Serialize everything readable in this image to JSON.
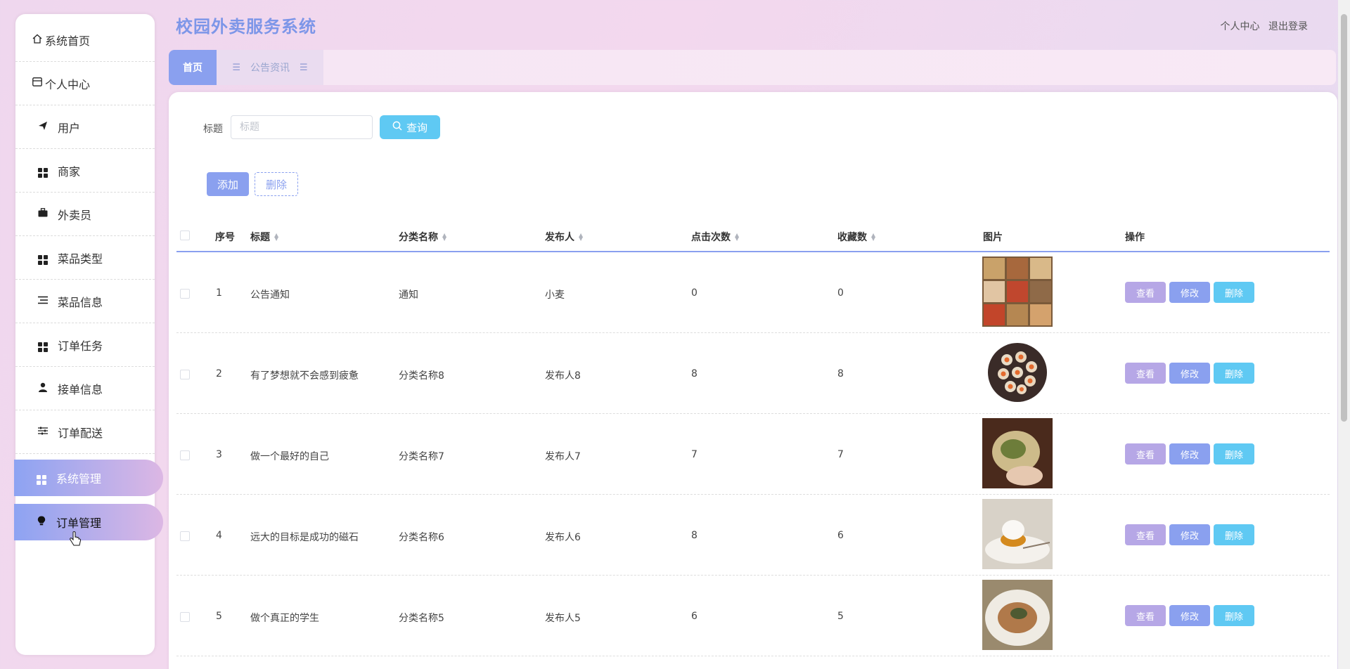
{
  "app": {
    "title": "校园外卖服务系统"
  },
  "header": {
    "profile": "个人中心",
    "logout": "退出登录"
  },
  "sidebar": {
    "items": [
      {
        "label": "系统首页",
        "icon": "home-icon"
      },
      {
        "label": "个人中心",
        "icon": "card-icon"
      },
      {
        "label": "用户",
        "icon": "send-icon"
      },
      {
        "label": "商家",
        "icon": "grid-icon"
      },
      {
        "label": "外卖员",
        "icon": "briefcase-icon"
      },
      {
        "label": "菜品类型",
        "icon": "grid-icon"
      },
      {
        "label": "菜品信息",
        "icon": "list-icon"
      },
      {
        "label": "订单任务",
        "icon": "grid-icon"
      },
      {
        "label": "接单信息",
        "icon": "user-icon"
      },
      {
        "label": "订单配送",
        "icon": "sliders-icon"
      },
      {
        "label": "系统管理",
        "icon": "grid-icon"
      },
      {
        "label": "订单管理",
        "icon": "bulb-icon"
      }
    ]
  },
  "tabs": [
    {
      "label": "首页"
    },
    {
      "label": "公告资讯"
    }
  ],
  "search": {
    "label": "标题",
    "placeholder": "标题",
    "button": "查询"
  },
  "actions": {
    "add": "添加",
    "delete": "删除"
  },
  "table": {
    "headers": [
      "序号",
      "标题",
      "分类名称",
      "发布人",
      "点击次数",
      "收藏数",
      "图片",
      "操作"
    ],
    "rows": [
      {
        "no": "1",
        "title": "公告通知",
        "category": "通知",
        "publisher": "小麦",
        "clicks": "0",
        "favorites": "0"
      },
      {
        "no": "2",
        "title": "有了梦想就不会感到疲惫",
        "category": "分类名称8",
        "publisher": "发布人8",
        "clicks": "8",
        "favorites": "8"
      },
      {
        "no": "3",
        "title": "做一个最好的自己",
        "category": "分类名称7",
        "publisher": "发布人7",
        "clicks": "7",
        "favorites": "7"
      },
      {
        "no": "4",
        "title": "远大的目标是成功的磁石",
        "category": "分类名称6",
        "publisher": "发布人6",
        "clicks": "8",
        "favorites": "6"
      },
      {
        "no": "5",
        "title": "做个真正的学生",
        "category": "分类名称5",
        "publisher": "发布人5",
        "clicks": "6",
        "favorites": "5"
      }
    ],
    "ops": {
      "view": "查看",
      "edit": "修改",
      "remove": "删除"
    }
  },
  "colors": {
    "accent": "#8aa0ef",
    "title": "#7d96e8",
    "info": "#5fc9f3",
    "view": "#b6a7e6"
  }
}
